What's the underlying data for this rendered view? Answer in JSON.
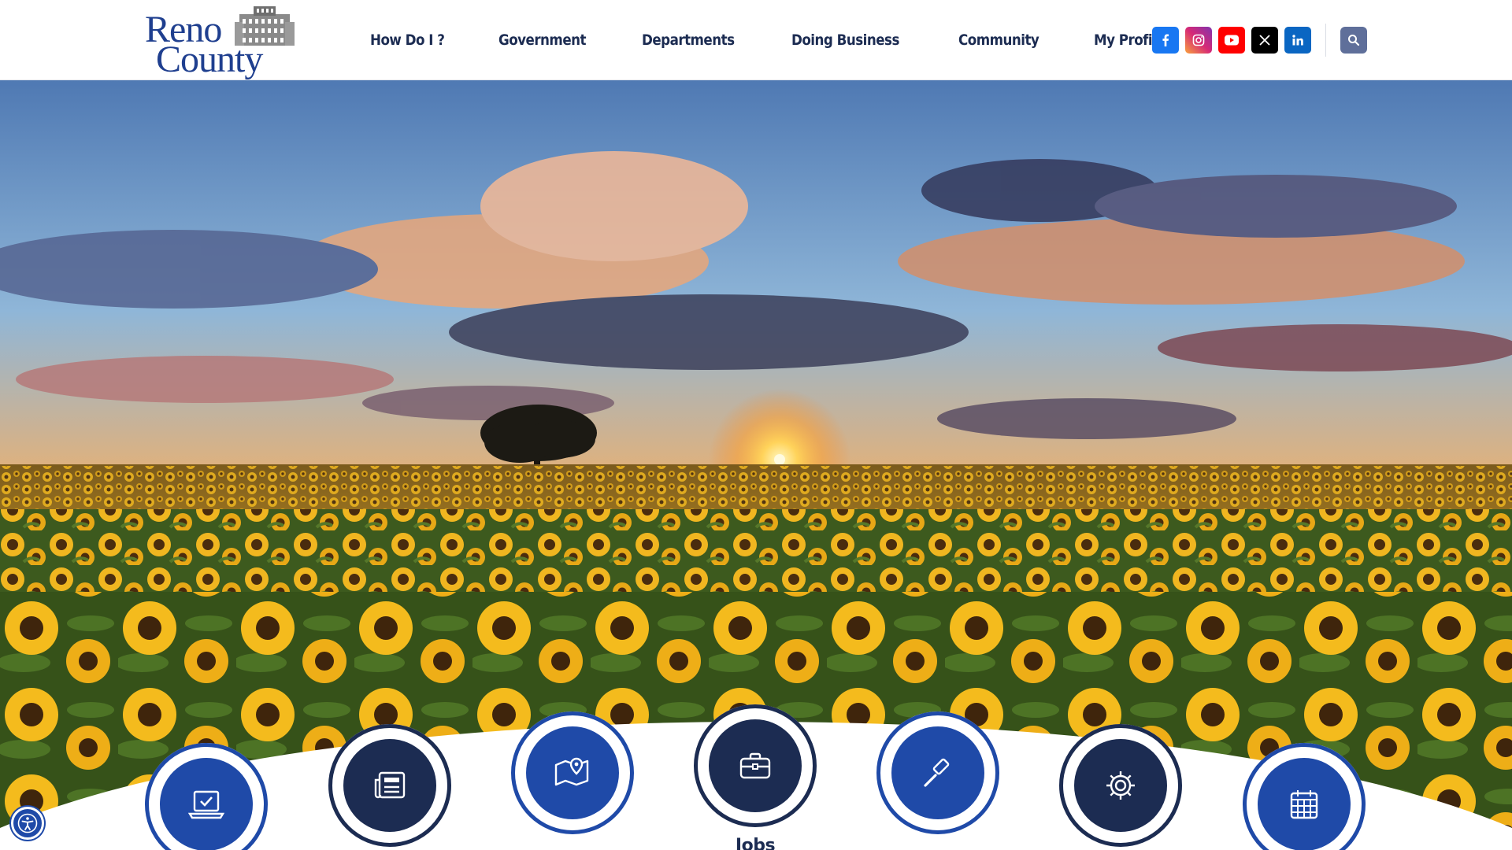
{
  "site": {
    "logo_line1": "Reno",
    "logo_line2": "County"
  },
  "nav": {
    "items": [
      {
        "label": "How Do I ?"
      },
      {
        "label": "Government"
      },
      {
        "label": "Departments"
      },
      {
        "label": "Doing Business"
      },
      {
        "label": "Community"
      },
      {
        "label": "My Profile"
      }
    ]
  },
  "socials": [
    {
      "icon": "facebook-icon",
      "color": "#1877f2"
    },
    {
      "icon": "instagram-icon",
      "color": "#d62976"
    },
    {
      "icon": "youtube-icon",
      "color": "#ff0000"
    },
    {
      "icon": "x-twitter-icon",
      "color": "#000000"
    },
    {
      "icon": "linkedin-icon",
      "color": "#0a66c2"
    }
  ],
  "search": {
    "icon": "search-icon",
    "color": "#5f6f9a"
  },
  "hero": {
    "image": "sunflower-field-sunset"
  },
  "quick_links": [
    {
      "icon": "laptop-check-icon",
      "label": ""
    },
    {
      "icon": "newspaper-icon",
      "label": ""
    },
    {
      "icon": "map-pin-icon",
      "label": ""
    },
    {
      "icon": "briefcase-icon",
      "label": "Jobs"
    },
    {
      "icon": "gavel-icon",
      "label": ""
    },
    {
      "icon": "gear-icon",
      "label": ""
    },
    {
      "icon": "calendar-icon",
      "label": ""
    }
  ],
  "colors": {
    "navy": "#1c2c52",
    "blue": "#1f4aa8"
  },
  "accessibility": {
    "icon": "accessibility-icon"
  }
}
